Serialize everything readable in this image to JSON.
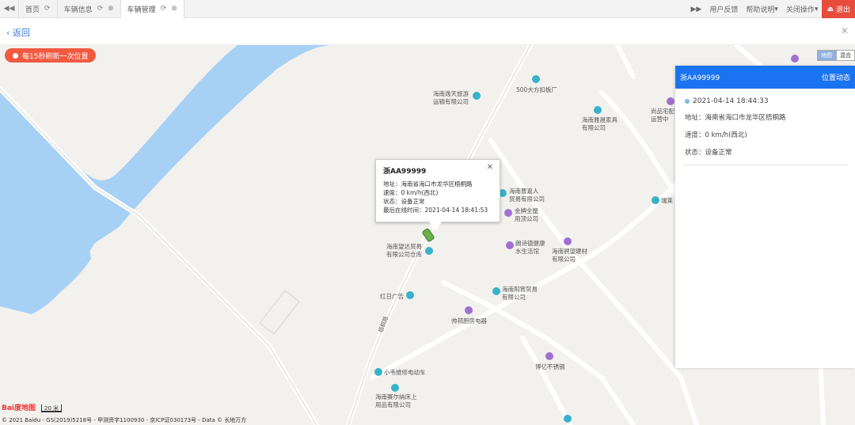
{
  "tabs": [
    {
      "label": "首页",
      "active": false,
      "closable": false
    },
    {
      "label": "车辆信息",
      "active": false,
      "closable": true
    },
    {
      "label": "车辆管理",
      "active": true,
      "closable": true
    }
  ],
  "topbar": {
    "feedback": "用户反馈",
    "help": "帮助说明",
    "close_ops": "关闭操作",
    "logout": "退出"
  },
  "back_label": "返回",
  "refresh_label": "每15秒刷新一次位置",
  "map_type": {
    "map": "地图",
    "hybrid": "混合"
  },
  "popup": {
    "plate": "浙AA99999",
    "address": "地址：海南省海口市龙华区梧桐路",
    "speed": "速度：0 km/h(西北)",
    "status": "状态：设备正常",
    "last_online": "最后在线时间：2021-04-14 18:41:53"
  },
  "panel": {
    "plate": "浙AA99999",
    "action": "位置动态",
    "time": "2021-04-14 18:44:33",
    "address": "地址：海南省海口市龙华区梧桐路",
    "speed": "速度：0 km/h(西北)",
    "status": "状态：设备正常"
  },
  "pois": {
    "p1": "海南逸天旅游",
    "p1b": "运输有限公司",
    "p2": "500大方扣板厂",
    "p3": "海南雅晟家具",
    "p3b": "有限公司",
    "p4": "尚品宅配",
    "p4b": "运营中",
    "p5": "海南曹嘉人",
    "p5b": "贸易有限公司",
    "p6": "金牌全屋",
    "p6b": "用顶公司",
    "p7": "瑞莱",
    "p8": "朗诗德健康",
    "p8b": "水生活馆",
    "p9": "海南骋望建材",
    "p9b": "有限公司",
    "p10": "海南望达贸易",
    "p10b": "有限公司仓库",
    "p11": "海南阳宵贸易",
    "p11b": "有限公司",
    "p12": "红日广告",
    "p13": "帅邦厨房电器",
    "p14": "博亿不锈钢",
    "p15": "小韦维修电动车",
    "p16": "海南赛尔纳床上",
    "p16b": "用品有限公司"
  },
  "road_label": "梧桐路",
  "scale_label": "20 米",
  "baidu_label": "Bai度地图",
  "copyright": "© 2021 Baidu - GS(2019)5218号 - 甲测资字1100930 - 京ICP证030173号 - Data © 长地万方"
}
